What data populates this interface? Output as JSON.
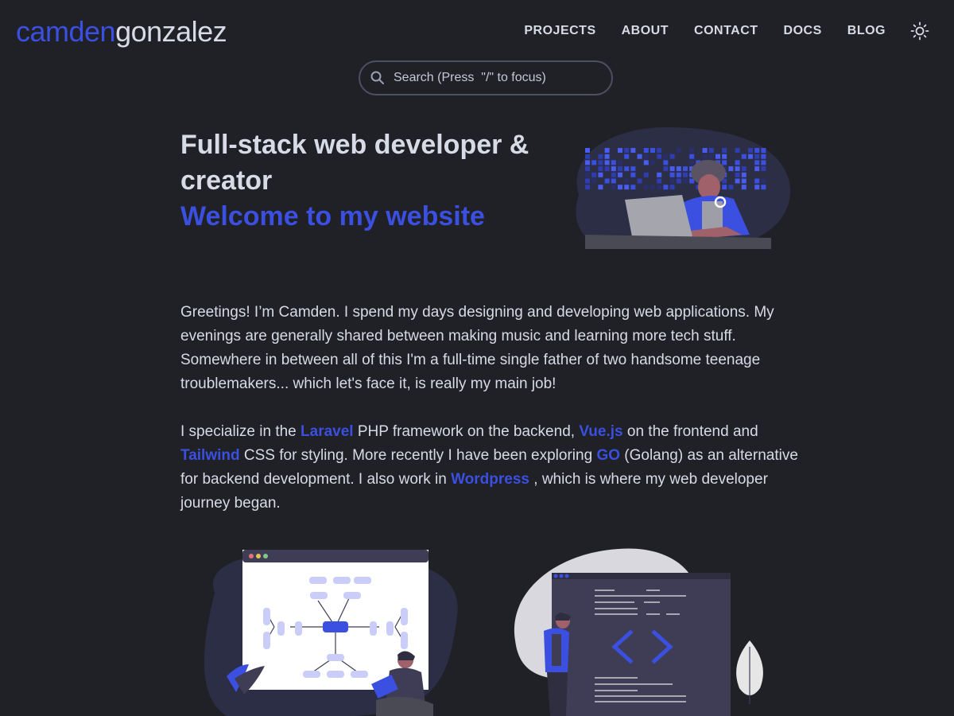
{
  "header": {
    "logo_first": "camden",
    "logo_last": "gonzalez",
    "nav": [
      "PROJECTS",
      "ABOUT",
      "CONTACT",
      "DOCS",
      "BLOG"
    ]
  },
  "search": {
    "placeholder": "Search (Press  \"/\" to focus)"
  },
  "hero": {
    "title": "Full-stack web developer & creator",
    "subtitle": "Welcome to my website"
  },
  "intro": {
    "paragraph1": "Greetings! I’m Camden. I spend my days designing and developing web applications. My evenings are generally shared between making music and learning more tech stuff. Somewhere in between all of this I'm a full-time single father of two handsome teenage troublemakers... which let's face it, is really my main job!",
    "p2_a": "I specialize in the ",
    "link_laravel": "Laravel",
    "p2_b": " PHP framework on the backend, ",
    "link_vue": "Vue.js",
    "p2_c": " on the frontend and ",
    "link_tailwind": "Tailwind",
    "p2_d": " CSS for styling. More recently I have been exploring ",
    "link_go": "GO",
    "p2_e": " (Golang) as an alternative for backend development. I also work in ",
    "link_wordpress": "Wordpress",
    "p2_f": " , which is where my web developer journey began."
  },
  "colors": {
    "background": "#202027",
    "accent": "#3b4fe0",
    "text": "#d7dbe6"
  },
  "icons": {
    "search": "search-icon",
    "theme": "sun-icon"
  }
}
